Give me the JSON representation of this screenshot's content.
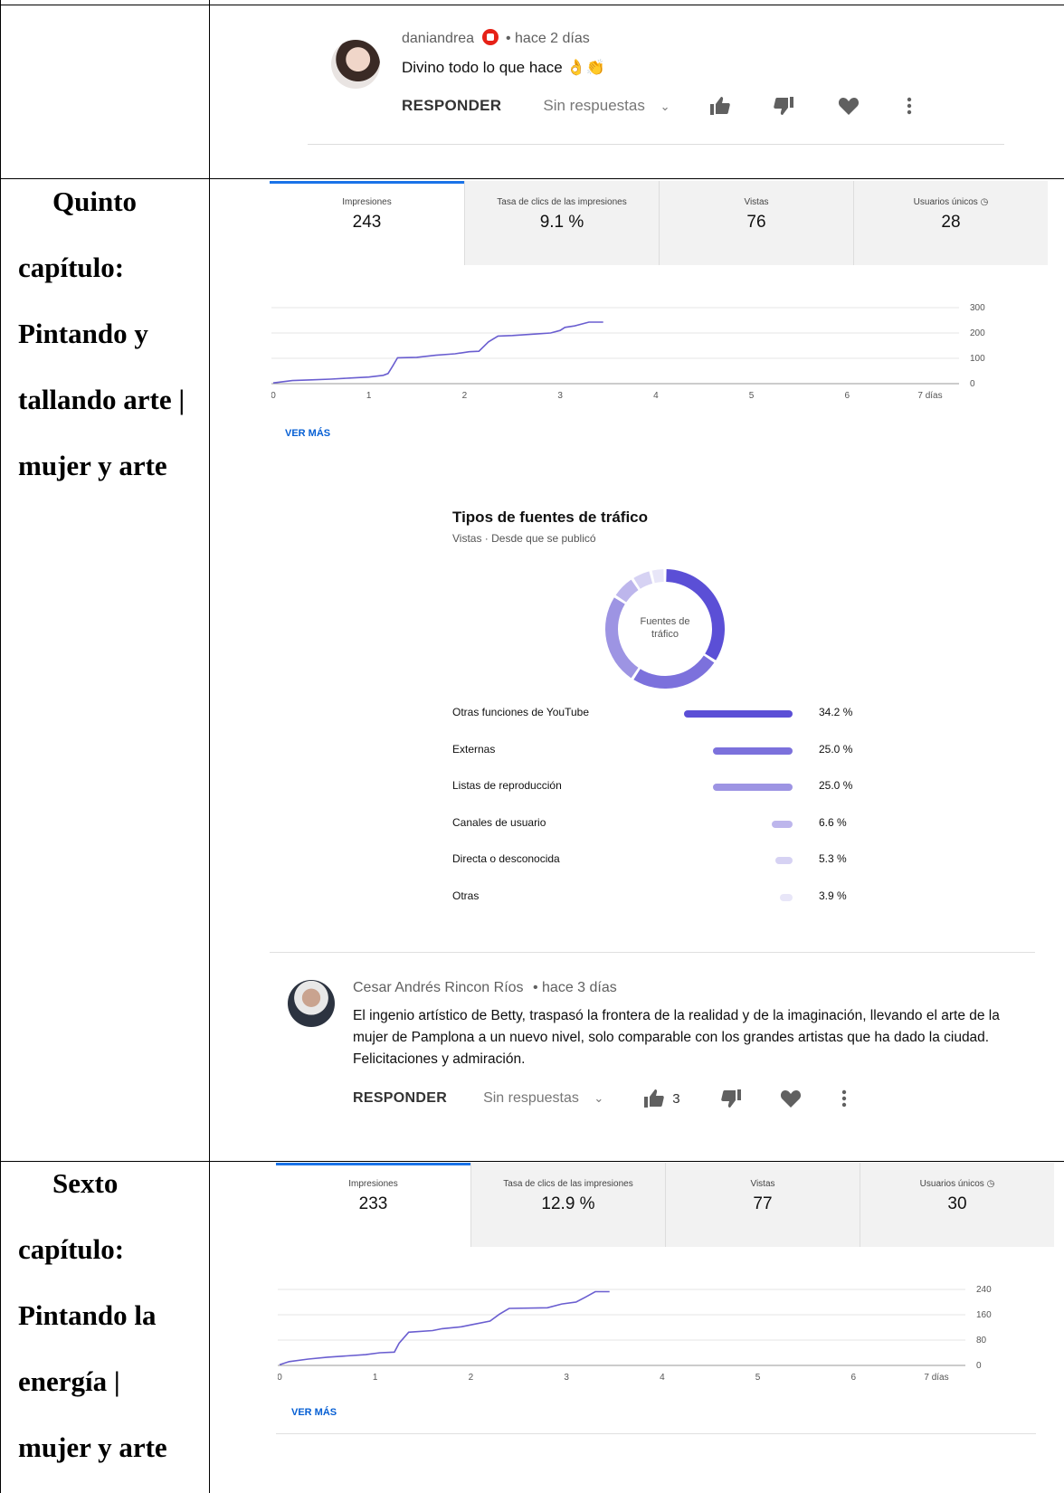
{
  "rows": {
    "row1": {
      "comment": {
        "author": "daniandrea",
        "time": "• hace 2 días",
        "text": "Divino todo lo que hace 👌👏",
        "reply": "RESPONDER",
        "replies": "Sin respuestas",
        "likes": ""
      }
    },
    "row2": {
      "chapter": [
        "Quinto",
        "capítulo:",
        "Pintando y",
        "tallando arte |",
        "mujer y arte"
      ],
      "tabs": [
        {
          "label": "Impresiones",
          "value": "243"
        },
        {
          "label": "Tasa de clics de las impresiones",
          "value": "9.1 %"
        },
        {
          "label": "Vistas",
          "value": "76"
        },
        {
          "label": "Usuarios únicos",
          "value": "28"
        }
      ],
      "ver_mas": "VER MÁS",
      "chart_data": {
        "type": "line",
        "xlabel": "",
        "ylabel": "",
        "x_ticks": [
          "0",
          "1",
          "2",
          "3",
          "4",
          "5",
          "6",
          "7 días"
        ],
        "y_ticks": [
          "0",
          "100",
          "200",
          "300"
        ],
        "ylim": [
          0,
          300
        ],
        "xlim": [
          0,
          7
        ],
        "color": "#6a5ed0",
        "grid": true,
        "series": [
          {
            "x": [
              0,
              0.2,
              0.4,
              0.6,
              0.8,
              1.0,
              1.15,
              1.2,
              1.25,
              1.3,
              1.5,
              1.7,
              1.9,
              2.05,
              2.15,
              2.25,
              2.35,
              2.5,
              2.75,
              2.9,
              3.0,
              3.05,
              3.15,
              3.3,
              3.45
            ],
            "y": [
              3,
              12,
              15,
              18,
              22,
              26,
              33,
              40,
              70,
              102,
              104,
              112,
              118,
              126,
              128,
              165,
              188,
              190,
              196,
              200,
              210,
              222,
              228,
              243,
              243
            ]
          }
        ]
      },
      "traffic": {
        "title": "Tipos de fuentes de tráfico",
        "subtitle": "Vistas · Desde que se publicó",
        "center_label_1": "Fuentes de",
        "center_label_2": "tráfico",
        "chart_data": {
          "type": "pie",
          "labels": [
            "Otras funciones de YouTube",
            "Externas",
            "Listas de reproducción",
            "Canales de usuario",
            "Directa o desconocida",
            "Otras"
          ],
          "values": [
            34.2,
            25.0,
            25.0,
            6.6,
            5.3,
            3.9
          ],
          "value_labels": [
            "34.2 %",
            "25.0 %",
            "25.0 %",
            "6.6 %",
            "5.3 %",
            "3.9 %"
          ],
          "colors": [
            "#5b4fd6",
            "#7c71dc",
            "#9d94e3",
            "#bdb6ec",
            "#d6d2f3",
            "#e8e6f8"
          ]
        }
      },
      "comment": {
        "author": "Cesar Andrés Rincon Ríos",
        "time": "• hace 3 días",
        "text": "El ingenio artístico de Betty, traspasó la frontera de la realidad y de la imaginación, llevando el arte de la mujer de Pamplona a un nuevo nivel, solo comparable con los grandes artistas que ha dado la ciudad. Felicitaciones y admiración.",
        "reply": "RESPONDER",
        "replies": "Sin respuestas",
        "likes": "3"
      }
    },
    "row3": {
      "chapter": [
        "Sexto",
        "capítulo:",
        "Pintando la",
        "energía |",
        "mujer y arte"
      ],
      "tabs": [
        {
          "label": "Impresiones",
          "value": "233"
        },
        {
          "label": "Tasa de clics de las impresiones",
          "value": "12.9 %"
        },
        {
          "label": "Vistas",
          "value": "77"
        },
        {
          "label": "Usuarios únicos",
          "value": "30"
        }
      ],
      "ver_mas": "VER MÁS",
      "chart_data": {
        "type": "line",
        "xlabel": "",
        "ylabel": "",
        "x_ticks": [
          "0",
          "1",
          "2",
          "3",
          "4",
          "5",
          "6",
          "7 días"
        ],
        "y_ticks": [
          "0",
          "80",
          "160",
          "240"
        ],
        "ylim": [
          0,
          240
        ],
        "xlim": [
          0,
          7
        ],
        "color": "#6a5ed0",
        "grid": true,
        "series": [
          {
            "x": [
              0,
              0.1,
              0.3,
              0.5,
              0.7,
              0.9,
              1.05,
              1.2,
              1.25,
              1.35,
              1.6,
              1.7,
              1.9,
              2.0,
              2.2,
              2.3,
              2.4,
              2.8,
              2.95,
              3.1,
              3.2,
              3.3,
              3.45
            ],
            "y": [
              2,
              12,
              20,
              26,
              30,
              34,
              40,
              42,
              70,
              105,
              110,
              116,
              122,
              128,
              140,
              162,
              180,
              182,
              194,
              200,
              216,
              233,
              233
            ]
          }
        ]
      }
    }
  }
}
